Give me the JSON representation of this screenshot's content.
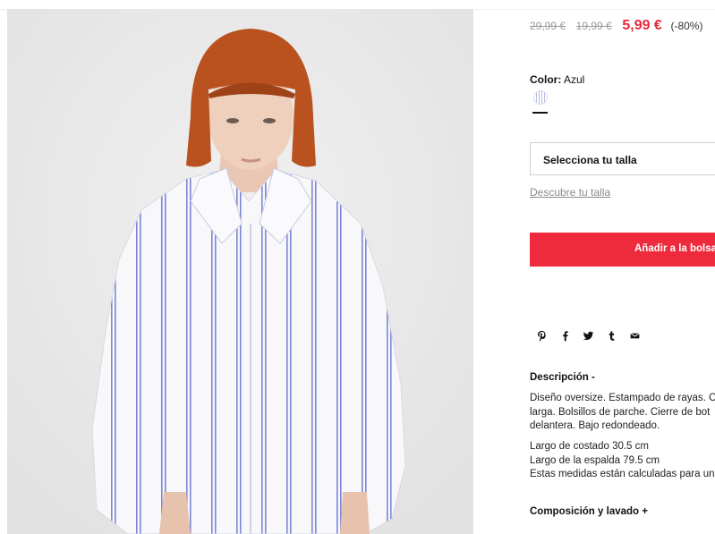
{
  "product": {
    "prices": {
      "original": "29,99 €",
      "previous": "19,99 €",
      "sale": "5,99 €",
      "discount": "(-80%)"
    },
    "color": {
      "label": "Color:",
      "value": "Azul"
    },
    "size_select": {
      "label": "Selecciona tu talla"
    },
    "size_link": "Descubre tu talla",
    "add_button": "Añadir a la bolsa",
    "share_icons": [
      "pinterest-icon",
      "facebook-icon",
      "twitter-icon",
      "tumblr-icon",
      "email-icon"
    ],
    "description": {
      "title": "Descripción -",
      "lines": [
        "Diseño oversize. Estampado de rayas. C",
        "larga. Bolsillos de parche. Cierre de bot",
        "delantera. Bajo redondeado."
      ],
      "measures": [
        "Largo de costado 30.5 cm",
        "Largo de la espalda 79.5 cm",
        "Estas medidas están calculadas para un"
      ]
    },
    "composition_title": "Composición y lavado +"
  },
  "colors": {
    "sale": "#ee2a3d",
    "text": "#111111",
    "muted": "#8a8a8a",
    "photo_bg": "#ebebeb",
    "stripe": "#7d86d6"
  }
}
